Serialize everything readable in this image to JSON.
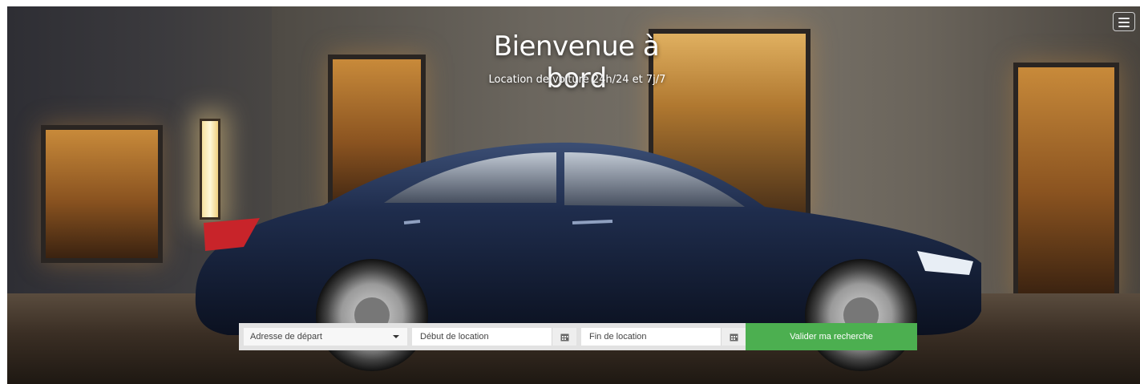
{
  "hero": {
    "title": "Bienvenue à bord",
    "subtitle": "Location de voiture 24h/24 et 7j/7"
  },
  "nav": {
    "menu_icon": "hamburger-icon"
  },
  "search": {
    "departure_placeholder": "Adresse de départ",
    "start_placeholder": "Début de location",
    "end_placeholder": "Fin de location",
    "submit_label": "Valider ma recherche",
    "calendar_icon": "calendar-icon",
    "dropdown_icon": "caret-down-icon"
  },
  "colors": {
    "submit_bg": "#4caf50",
    "field_bg": "#ffffff",
    "field_border": "#e2e2e2",
    "car_body": "#1c2a4a"
  }
}
